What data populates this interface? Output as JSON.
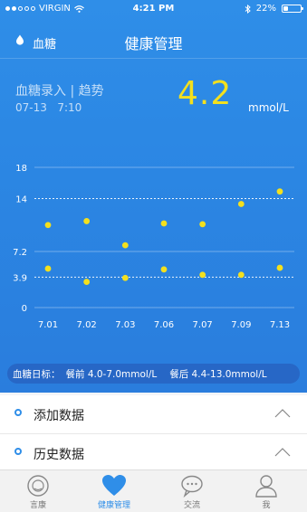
{
  "status_bar": {
    "carrier": "VIRGIN",
    "time": "4:21 PM",
    "battery": "22%"
  },
  "header": {
    "left_label": "血糖",
    "title": "健康管理"
  },
  "summary": {
    "entry_label": "血糖录入 | 趋势",
    "date": "07-13",
    "time": "7:10",
    "value": "4.2",
    "unit": "mmol/L"
  },
  "chart_data": {
    "type": "scatter",
    "title": "",
    "xlabel": "",
    "ylabel": "",
    "categories": [
      "7.01",
      "7.02",
      "7.03",
      "7.06",
      "7.07",
      "7.09",
      "7.13"
    ],
    "y_ticks": [
      0,
      3.9,
      7.2,
      14,
      18
    ],
    "ylim": [
      0,
      18
    ],
    "series": [
      {
        "values": [
          10.6,
          11.1,
          8.0,
          10.8,
          10.7,
          13.3,
          14.9
        ]
      },
      {
        "values": [
          5.0,
          3.3,
          3.8,
          4.9,
          4.2,
          4.2,
          5.1
        ]
      }
    ],
    "reference_lines": [
      3.9,
      14
    ],
    "colors": {
      "points": "#f3e01e",
      "grid": "#ffffff"
    }
  },
  "target_range": {
    "label": "血糖日标：",
    "before_meal": "餐前  4.0-7.0mmol/L",
    "after_meal": "餐后  4.4-13.0mmol/L"
  },
  "sections": [
    {
      "label": "添加数据"
    },
    {
      "label": "历史数据"
    }
  ],
  "tabs": [
    {
      "label": "言康",
      "icon": "smile-icon"
    },
    {
      "label": "健康管理",
      "icon": "heart-icon"
    },
    {
      "label": "交流",
      "icon": "chat-icon"
    },
    {
      "label": "我",
      "icon": "user-icon"
    }
  ],
  "colors": {
    "primary": "#2f8ee8",
    "accent": "#f3e01e"
  }
}
